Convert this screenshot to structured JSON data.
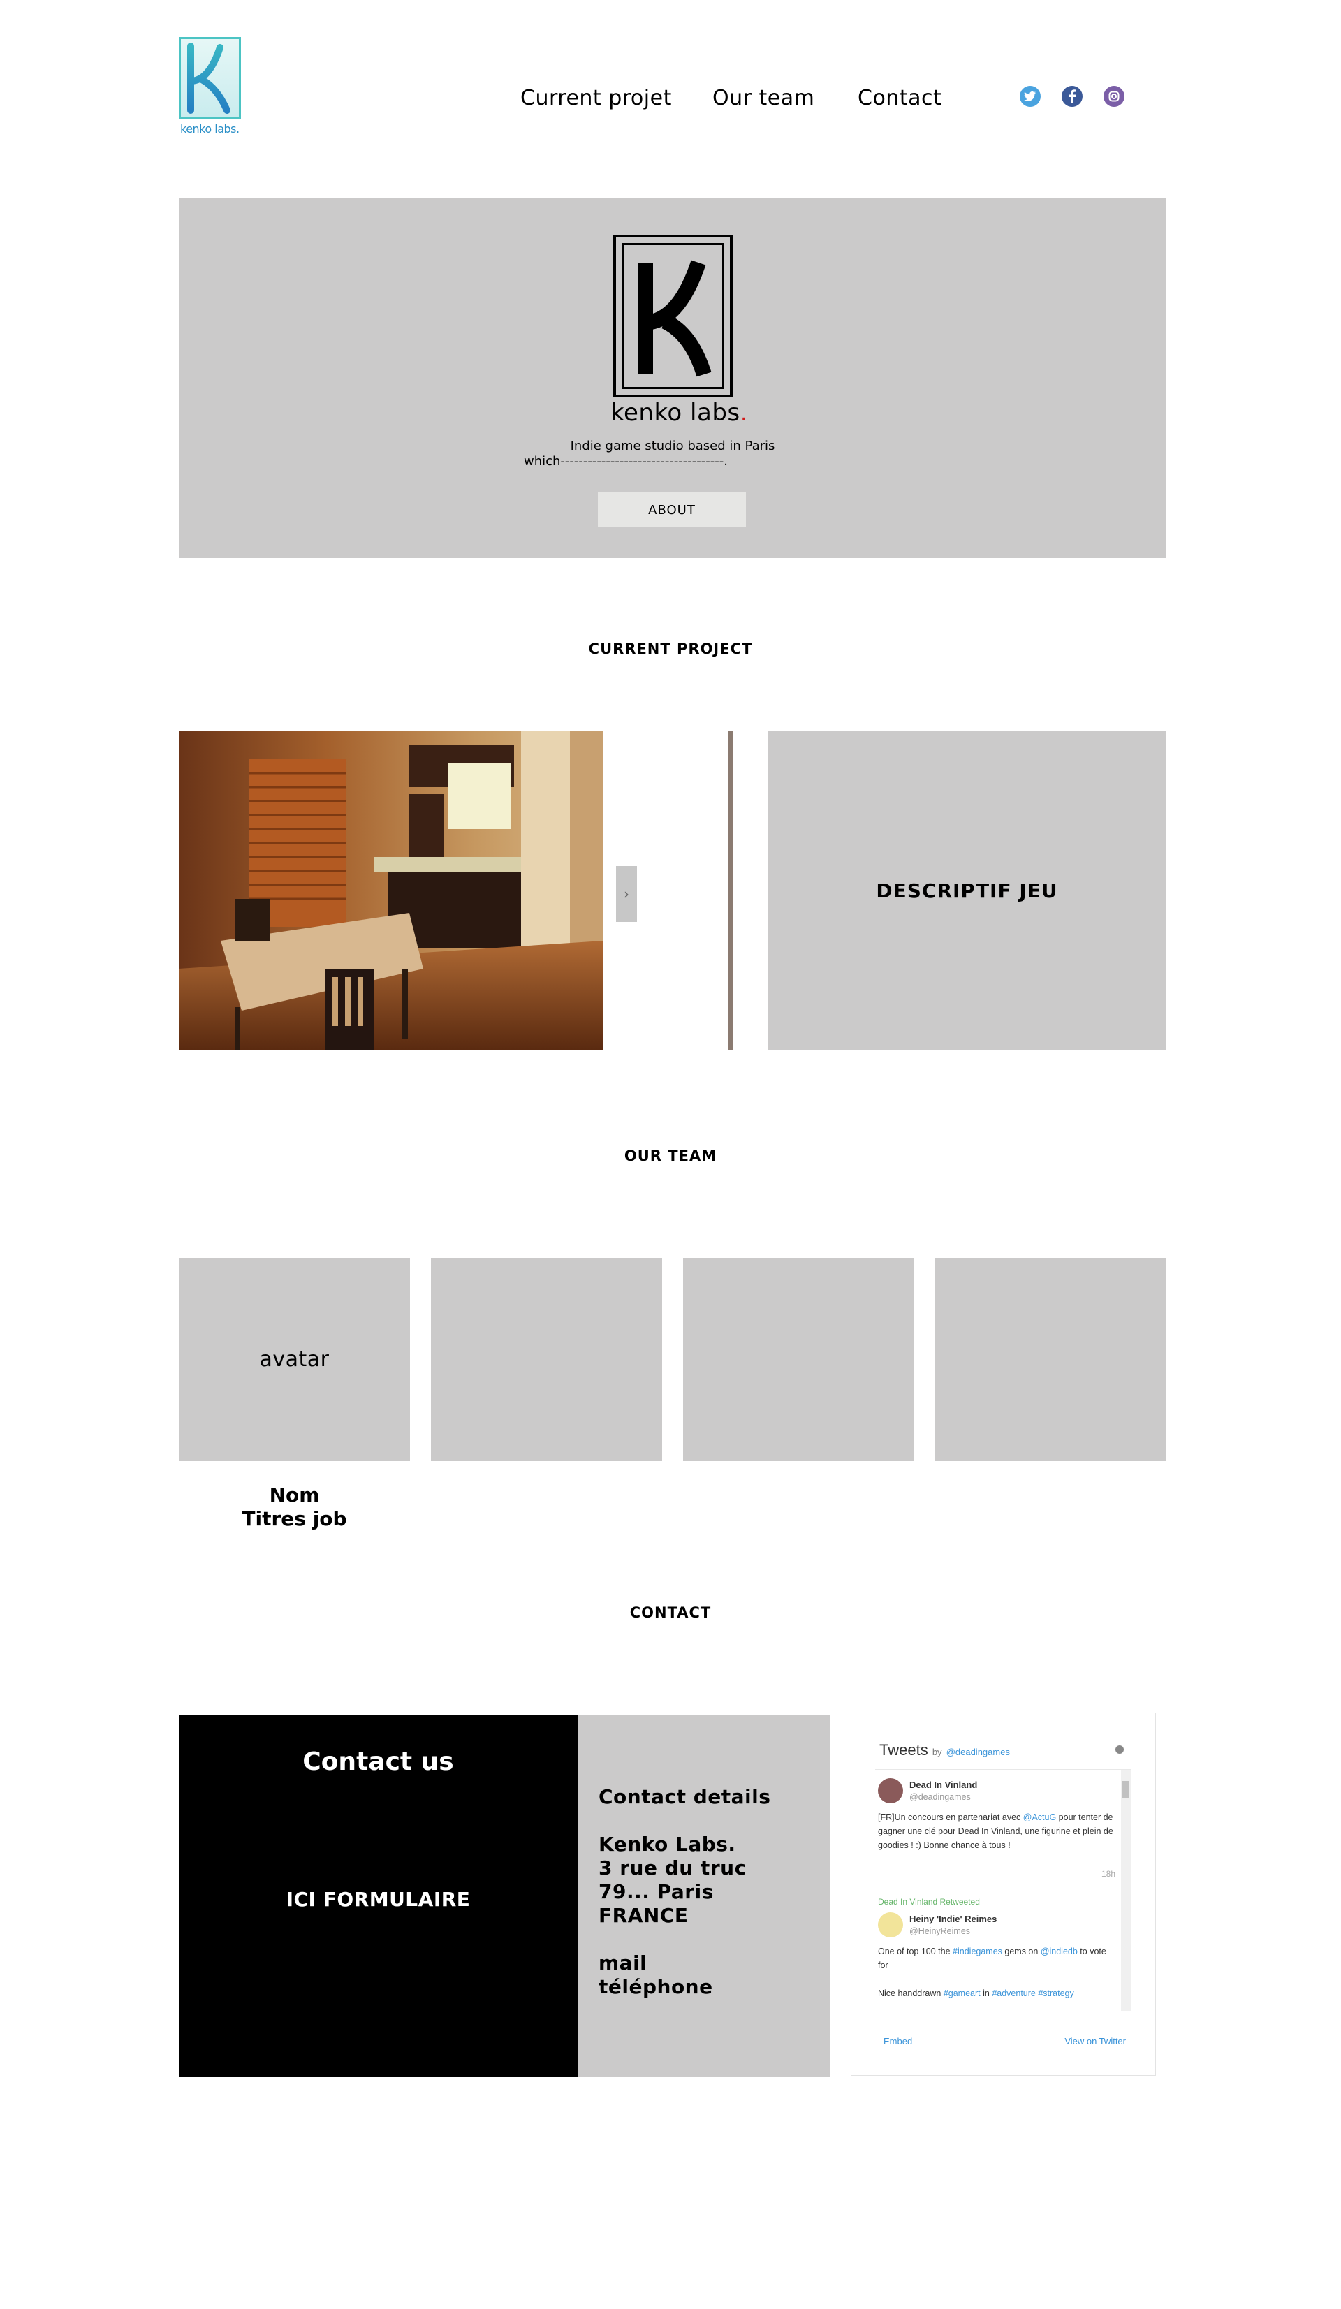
{
  "header": {
    "logo_text": "kenko labs.",
    "nav": [
      "Current projet",
      "Our team",
      "Contact"
    ],
    "social": [
      "twitter-icon",
      "facebook-icon",
      "instagram-icon"
    ]
  },
  "hero": {
    "brand": "kenko labs",
    "tagline": "Indie game studio based in Paris",
    "which_line": "which------------------------------------.",
    "about_label": "ABOUT"
  },
  "project": {
    "title": "CURRENT PROJECT",
    "next_glyph": "›",
    "description": "DESCRIPTIF JEU"
  },
  "team": {
    "title": "OUR TEAM",
    "avatar_label": "avatar",
    "name": "Nom",
    "job": "Titres job"
  },
  "contact": {
    "title": "CONTACT",
    "form_title": "Contact us",
    "form_placeholder": "ICI FORMULAIRE",
    "details_title": "Contact details",
    "address": [
      "Kenko Labs.",
      "3 rue du truc",
      "79... Paris",
      "FRANCE"
    ],
    "mail": "mail",
    "phone": "téléphone"
  },
  "twitter": {
    "heading": "Tweets",
    "by": "by",
    "handle": "@deadingames",
    "tweet1": {
      "name": "Dead In Vinland",
      "handle": "@deadingames",
      "text_a": "[FR]Un concours en partenariat avec ",
      "mention": "@ActuG",
      "text_b": " pour tenter de gagner une clé pour Dead In Vinland, une figurine et plein de goodies ! :) Bonne chance à tous !",
      "time": "18h"
    },
    "tweet2": {
      "retweet_label": "Dead In Vinland Retweeted",
      "name": "Heiny 'Indie' Reimes",
      "handle": "@HeinyReimes",
      "text_a": "One of top 100 the ",
      "hashtag1": "#indiegames",
      "text_b": " gems on ",
      "mention": "@indiedb",
      "text_c": " to vote for",
      "text_d": "Nice handdrawn ",
      "hashtag2": "#gameart",
      "text_e": " in ",
      "hashtag3": "#adventure #strategy"
    },
    "embed": "Embed",
    "view": "View on Twitter"
  },
  "colors": {
    "panel_gray": "#cbcaca",
    "divider_brown": "#8b7b71",
    "logo_teal": "#4cc4c4",
    "twitter_blue": "#3b94d9"
  }
}
